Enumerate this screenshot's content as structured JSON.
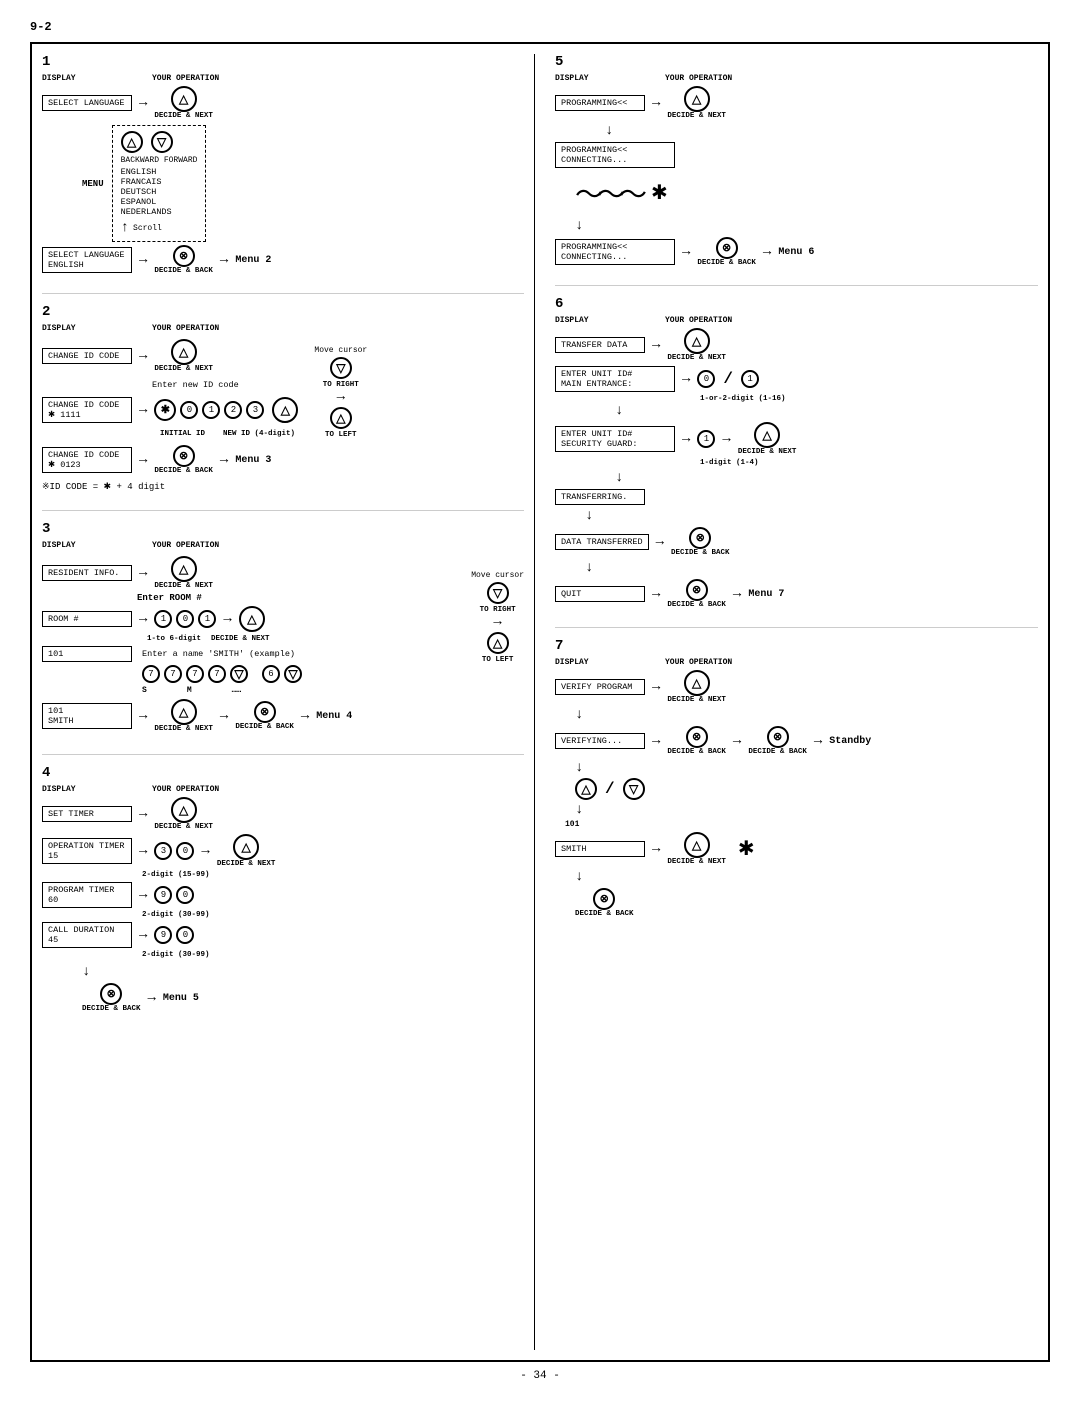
{
  "pageNum": "9-2",
  "footer": "- 34 -",
  "sections": {
    "s1": {
      "num": "1",
      "display_label": "DISPLAY",
      "op_label": "YOUR OPERATION",
      "box1": "SELECT LANGUAGE",
      "decide_next": "DECIDE & NEXT",
      "decide_back": "DECIDE & BACK",
      "menu_label": "MENU",
      "languages": "ENGLISH\nFRANCAIS\nDEUTSCH\nESPANOL\nNEDERLANDS",
      "backward_forward": "BACKWARD  FORWARD",
      "scroll": "Scroll",
      "box2": "SELECT LANGUAGE\nENGLISH",
      "menu2": "Menu 2"
    },
    "s2": {
      "num": "2",
      "display_label": "DISPLAY",
      "op_label": "YOUR OPERATION",
      "box1": "CHANGE ID CODE",
      "move_cursor": "Move cursor",
      "to_right": "TO RIGHT",
      "to_left": "TO LEFT",
      "decide_next": "DECIDE & NEXT",
      "decide_back": "DECIDE & BACK",
      "enter_new_id": "Enter new ID code",
      "box2": "CHANGE ID CODE\n✱ 1111",
      "initial_id": "INITIAL ID",
      "new_id": "NEW ID (4-digit)",
      "box3": "CHANGE ID CODE\n✱ 0123",
      "menu3": "Menu 3",
      "id_code_note": "※ID CODE = ✱ + 4 digit"
    },
    "s3": {
      "num": "3",
      "display_label": "DISPLAY",
      "op_label": "YOUR OPERATION",
      "box1": "RESIDENT INFO.",
      "move_cursor": "Move cursor",
      "to_right": "TO RIGHT",
      "to_left": "TO LEFT",
      "decide_next": "DECIDE & NEXT",
      "decide_back": "DECIDE & BACK",
      "enter_room": "Enter ROOM #",
      "box2": "ROOM #",
      "one_to_six": "1-to 6-digit",
      "box3": "101",
      "enter_name": "Enter a name 'SMITH' (example)",
      "s_label": "S",
      "m_label": "M",
      "dots": "……",
      "box4": "101\nSMITH",
      "menu4": "Menu 4"
    },
    "s4": {
      "num": "4",
      "display_label": "DISPLAY",
      "op_label": "YOUR OPERATION",
      "box1": "SET TIMER",
      "decide_next": "DECIDE & NEXT",
      "decide_back": "DECIDE & BACK",
      "box2": "OPERATION TIMER\n15",
      "two_digit_15": "2-digit (15-99)",
      "box3": "PROGRAM TIMER\n60",
      "two_digit_30": "2-digit (30-99)",
      "box4": "CALL DURATION\n45",
      "two_digit_30b": "2-digit (30-99)",
      "menu5": "Menu 5"
    },
    "s5": {
      "num": "5",
      "display_label": "DISPLAY",
      "op_label": "YOUR OPERATION",
      "box1": "PROGRAMMING<<",
      "decide_next": "DECIDE & NEXT",
      "decide_back": "DECIDE & BACK",
      "box2": "PROGRAMMING<<\nCONNECTING...",
      "box3": "PROGRAMMING<<\nCONNECTING...",
      "menu6": "Menu 6"
    },
    "s6": {
      "num": "6",
      "display_label": "DISPLAY",
      "op_label": "YOUR OPERATION",
      "box1": "TRANSFER DATA",
      "decide_next": "DECIDE & NEXT",
      "decide_back": "DECIDE & BACK",
      "box2": "ENTER UNIT ID#\nMAIN ENTRANCE:",
      "one_or_two": "1-or-2-digit (1-16)",
      "box3": "ENTER UNIT ID#\nSECURITY GUARD:",
      "one_digit": "1-digit (1-4)",
      "box4": "TRANSFERRING.",
      "box5": "DATA TRANSFERRED",
      "box6": "QUIT",
      "menu7": "Menu 7"
    },
    "s7": {
      "num": "7",
      "display_label": "DISPLAY",
      "op_label": "YOUR OPERATION",
      "box1": "VERIFY PROGRAM",
      "decide_next": "DECIDE & NEXT",
      "decide_back": "DECIDE & BACK",
      "box2": "VERIFYING...",
      "standby": "Standby",
      "box3": "101\nSMITH",
      "note_101": "101"
    }
  }
}
